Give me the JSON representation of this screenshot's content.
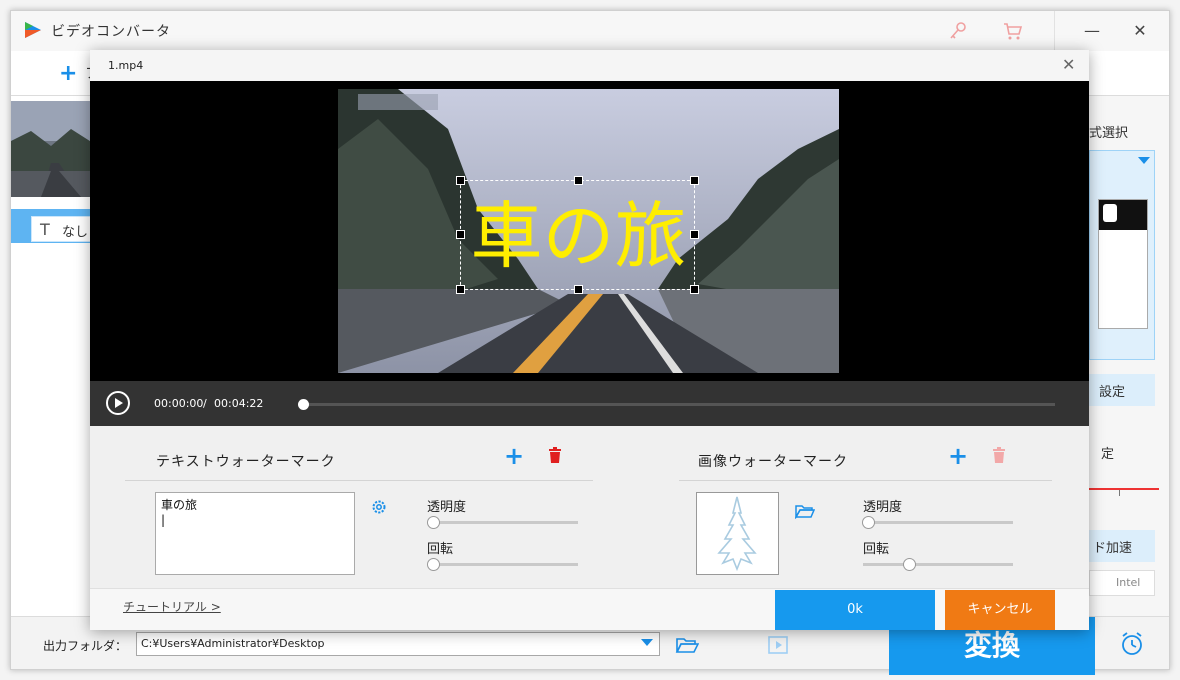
{
  "app": {
    "title": "ビデオコンバータ",
    "toolbar_add_partial": "フ",
    "text_tag_label": "なし",
    "right_panel": {
      "format_label": "式選択",
      "settings_label": "設定",
      "quality_label": "定",
      "hw_accel_label": "ド加速",
      "intel_label": "Intel"
    },
    "output_label": "出力フォルダ：",
    "output_path": "C:¥Users¥Administrator¥Desktop",
    "convert_label": "変換"
  },
  "dialog": {
    "title": "1.mp4",
    "close_symbol": "✕",
    "watermark_text": "車の旅",
    "player": {
      "current_time": "00:00:00",
      "separator": "/",
      "total_time": "00:04:22",
      "progress": 0
    },
    "text_watermark": {
      "title": "テキストウォーターマーク",
      "text_value": "車の旅",
      "opacity_label": "透明度",
      "rotate_label": "回転",
      "opacity": 0,
      "rotation": 0
    },
    "image_watermark": {
      "title": "画像ウォーターマーク",
      "opacity_label": "透明度",
      "rotate_label": "回転",
      "opacity": 0,
      "rotation": 0.27
    },
    "tutorial_link": "チュートリアル >",
    "ok_label": "0k",
    "cancel_label": "キャンセル"
  },
  "colors": {
    "accent": "#1699ee",
    "cancel": "#f07a14",
    "watermark": "#ffee00",
    "delete_active": "#e02020",
    "delete_disabled": "#f2a8a8"
  }
}
